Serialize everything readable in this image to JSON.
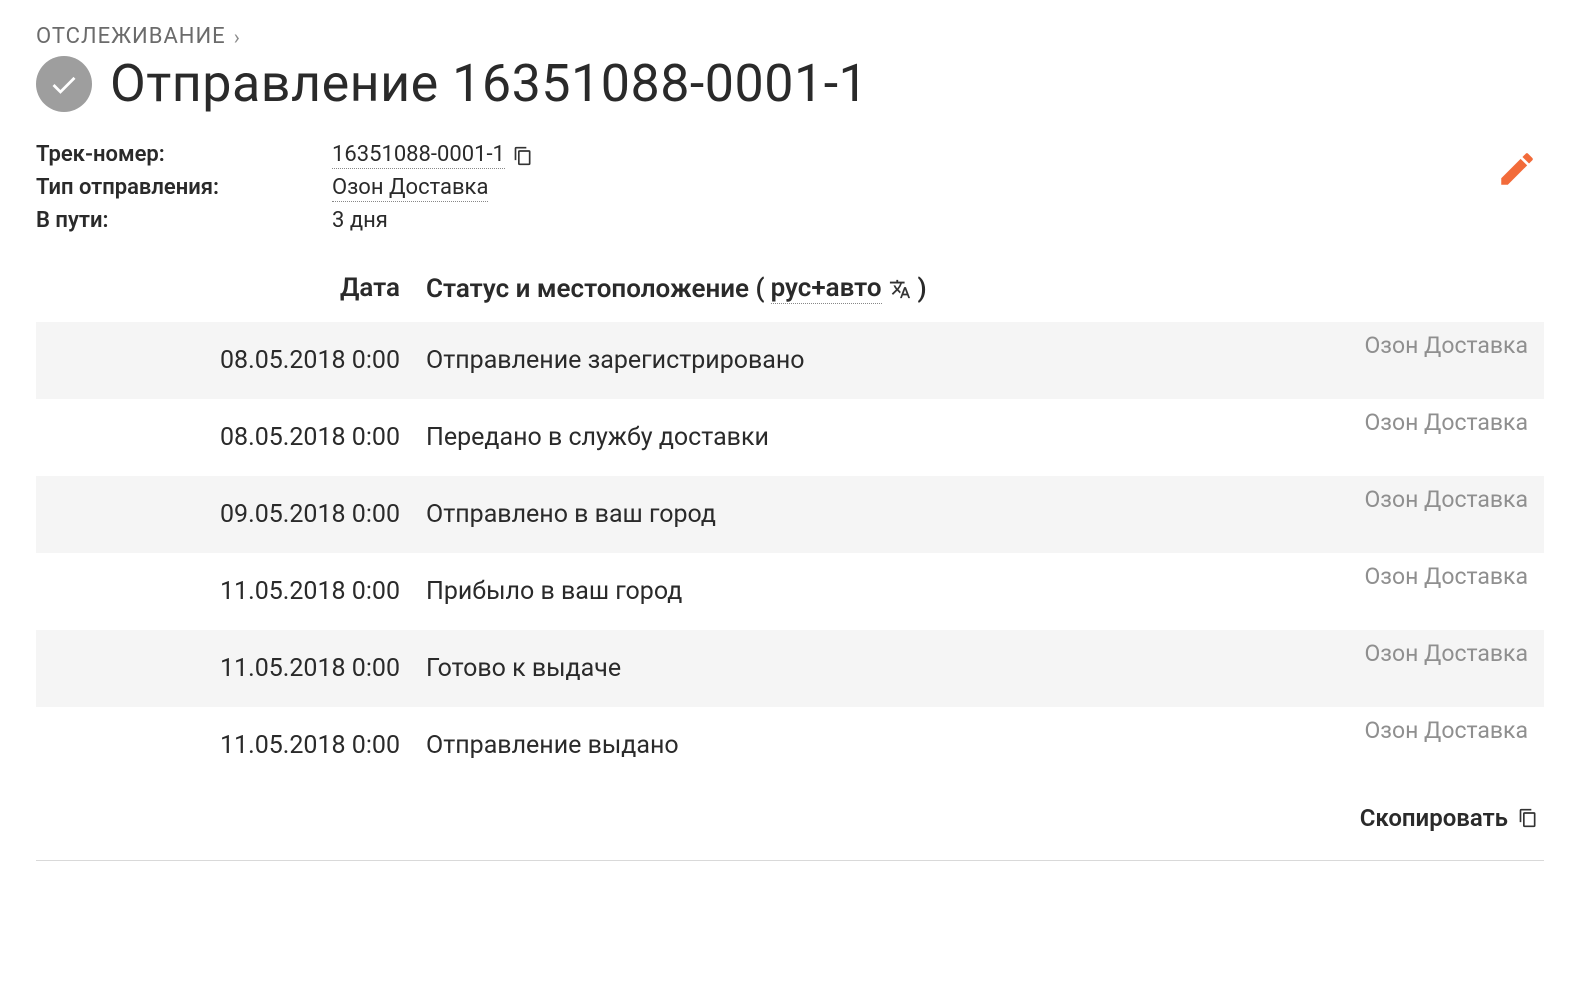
{
  "breadcrumb": {
    "label": "ОТСЛЕЖИВАНИЕ"
  },
  "title": "Отправление 16351088-0001-1",
  "meta": {
    "track_label": "Трек-номер:",
    "track_value": "16351088-0001-1",
    "type_label": "Тип отправления:",
    "type_value": "Озон Доставка",
    "transit_label": "В пути:",
    "transit_value": "3 дня"
  },
  "columns": {
    "date": "Дата",
    "status_prefix": "Статус и местоположение (",
    "lang": "рус+авто",
    "status_suffix": ")"
  },
  "carrier": "Озон Доставка",
  "events": [
    {
      "date": "08.05.2018 0:00",
      "status": "Отправление зарегистрировано"
    },
    {
      "date": "08.05.2018 0:00",
      "status": "Передано в службу доставки"
    },
    {
      "date": "09.05.2018 0:00",
      "status": "Отправлено в ваш город"
    },
    {
      "date": "11.05.2018 0:00",
      "status": "Прибыло в ваш город"
    },
    {
      "date": "11.05.2018 0:00",
      "status": "Готово к выдаче"
    },
    {
      "date": "11.05.2018 0:00",
      "status": "Отправление выдано"
    }
  ],
  "footer": {
    "copy": "Скопировать"
  }
}
